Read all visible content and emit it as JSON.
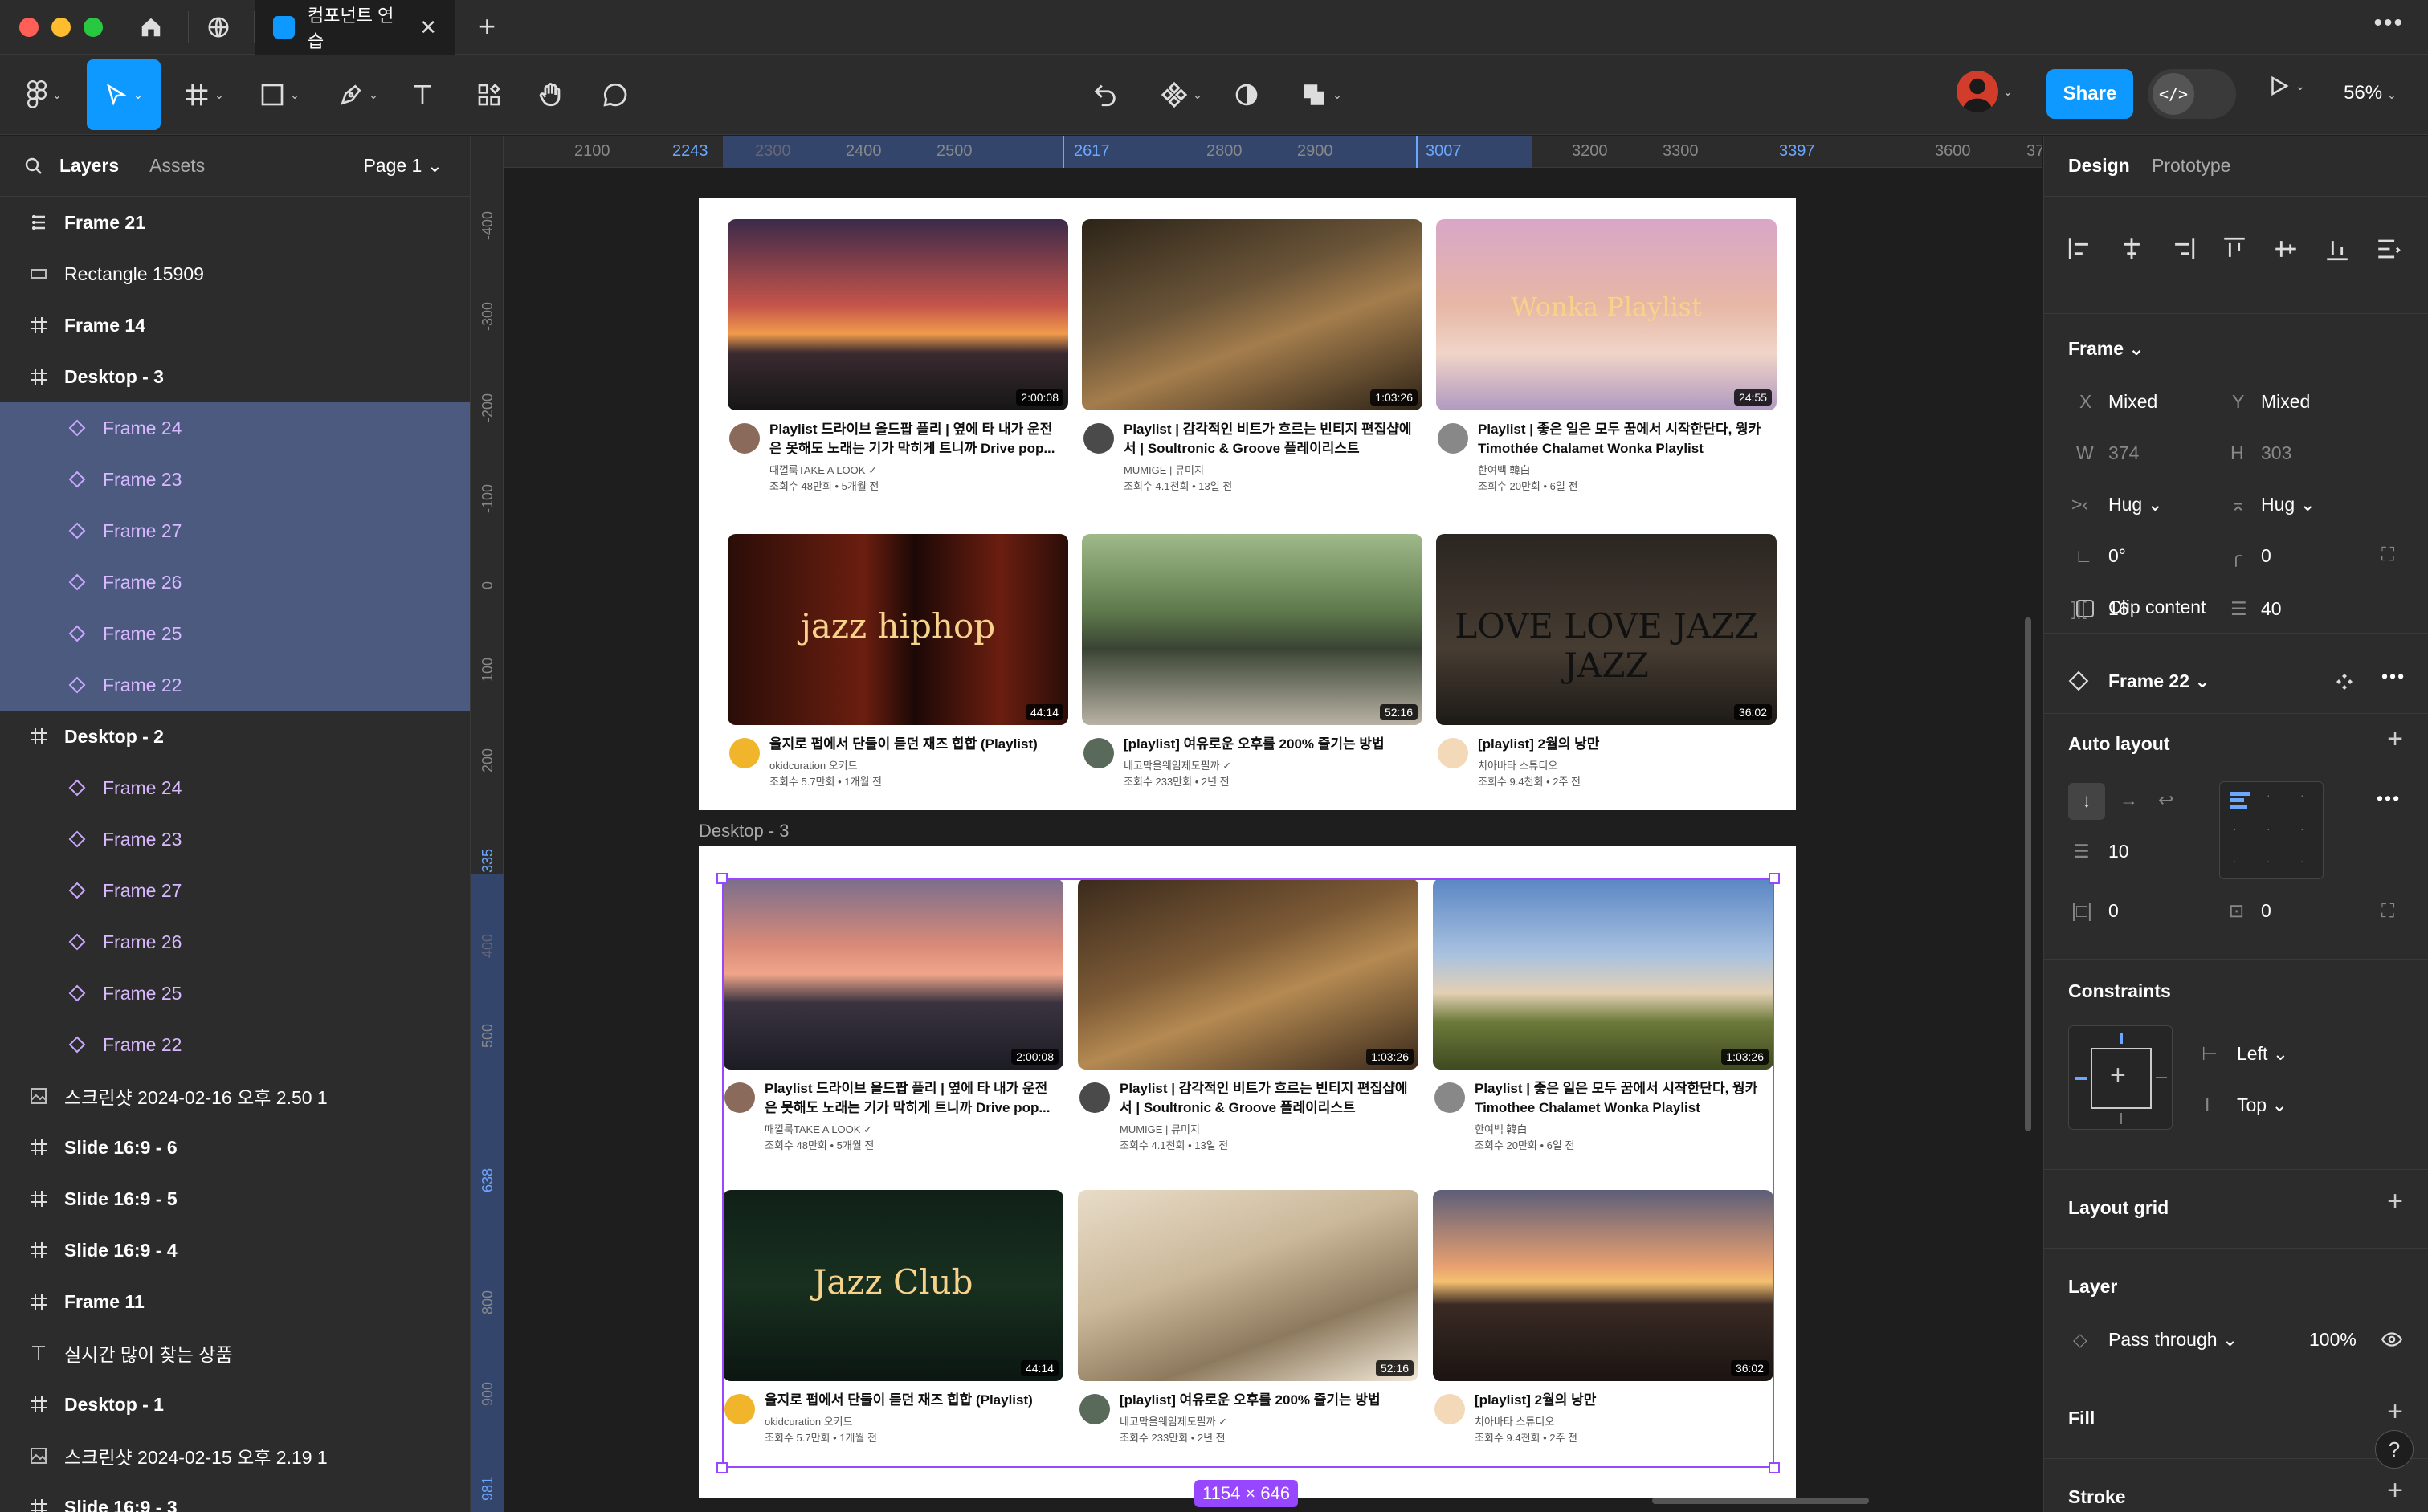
{
  "titlebar": {
    "file_tab_label": "컴포넌트 연습",
    "close_symbol": "✕",
    "new_tab_symbol": "+",
    "more_symbol": "•••"
  },
  "toolbar": {
    "share_label": "Share",
    "dev_mode_symbol": "</>",
    "zoom_label": "56%"
  },
  "left_panel": {
    "tabs": [
      "Layers",
      "Assets"
    ],
    "page_select": "Page 1 ⌄",
    "layers": [
      {
        "label": "Frame 21",
        "icon": "autolayout-icon",
        "level": 0,
        "selected": false,
        "bold": true
      },
      {
        "label": "Rectangle 15909",
        "icon": "rectangle-icon",
        "level": 0,
        "selected": false,
        "bold": false
      },
      {
        "label": "Frame 14",
        "icon": "frame-icon",
        "level": 0,
        "selected": false,
        "bold": true
      },
      {
        "label": "Desktop - 3",
        "icon": "frame-icon",
        "level": 0,
        "selected": false,
        "bold": true
      },
      {
        "label": "Frame 24",
        "icon": "instance-icon",
        "level": 1,
        "selected": true
      },
      {
        "label": "Frame 23",
        "icon": "instance-icon",
        "level": 1,
        "selected": true
      },
      {
        "label": "Frame 27",
        "icon": "instance-icon",
        "level": 1,
        "selected": true
      },
      {
        "label": "Frame 26",
        "icon": "instance-icon",
        "level": 1,
        "selected": true
      },
      {
        "label": "Frame 25",
        "icon": "instance-icon",
        "level": 1,
        "selected": true
      },
      {
        "label": "Frame 22",
        "icon": "instance-icon",
        "level": 1,
        "selected": true
      },
      {
        "label": "Desktop - 2",
        "icon": "frame-icon",
        "level": 0,
        "selected": false,
        "bold": true
      },
      {
        "label": "Frame 24",
        "icon": "instance-icon",
        "level": 1,
        "selected": false
      },
      {
        "label": "Frame 23",
        "icon": "instance-icon",
        "level": 1,
        "selected": false
      },
      {
        "label": "Frame 27",
        "icon": "instance-icon",
        "level": 1,
        "selected": false
      },
      {
        "label": "Frame 26",
        "icon": "instance-icon",
        "level": 1,
        "selected": false
      },
      {
        "label": "Frame 25",
        "icon": "instance-icon",
        "level": 1,
        "selected": false
      },
      {
        "label": "Frame 22",
        "icon": "instance-icon",
        "level": 1,
        "selected": false
      },
      {
        "label": "스크린샷 2024-02-16 오후 2.50 1",
        "icon": "image-icon",
        "level": 0,
        "selected": false,
        "bold": false
      },
      {
        "label": "Slide 16:9 - 6",
        "icon": "frame-icon",
        "level": 0,
        "selected": false,
        "bold": true
      },
      {
        "label": "Slide 16:9 - 5",
        "icon": "frame-icon",
        "level": 0,
        "selected": false,
        "bold": true
      },
      {
        "label": "Slide 16:9 - 4",
        "icon": "frame-icon",
        "level": 0,
        "selected": false,
        "bold": true
      },
      {
        "label": "Frame 11",
        "icon": "frame-icon",
        "level": 0,
        "selected": false,
        "bold": true
      },
      {
        "label": "실시간 많이 찾는 상품",
        "icon": "text-icon",
        "level": 0,
        "selected": false,
        "bold": false
      },
      {
        "label": "Desktop - 1",
        "icon": "frame-icon",
        "level": 0,
        "selected": false,
        "bold": true
      },
      {
        "label": "스크린샷 2024-02-15 오후 2.19 1",
        "icon": "image-icon",
        "level": 0,
        "selected": false,
        "bold": false
      },
      {
        "label": "Slide 16:9 - 3",
        "icon": "frame-icon",
        "level": 0,
        "selected": false,
        "bold": true
      }
    ]
  },
  "canvas": {
    "ruler_top": [
      "2100",
      "2243",
      "2300",
      "2400",
      "2500",
      "2617",
      "2800",
      "2900",
      "3007",
      "3200",
      "3300",
      "3397",
      "3600",
      "37"
    ],
    "ruler_left": [
      "-400",
      "-300",
      "-200",
      "-100",
      "0",
      "100",
      "200",
      "335",
      "400",
      "500",
      "638",
      "800",
      "900",
      "981"
    ],
    "frame_top_label": "",
    "frame_bottom_label": "Desktop - 3",
    "size_badge": "1154 × 646",
    "top_cards": [
      {
        "title": "Playlist 드라이브 올드팝 플리 | 옆에 타 내가 운전은 못해도 노래는 기가 막히게 트니까 Drive pop...",
        "channel": "때껄룩TAKE A LOOK ✓",
        "stats": "조회수 48만회 • 5개월 전",
        "duration": "2:00:08",
        "overlay": ""
      },
      {
        "title": "Playlist | 감각적인 비트가 흐르는 빈티지 편집샵에서 | Soultronic & Groove 플레이리스트",
        "channel": "MUMIGE | 뮤미지",
        "stats": "조회수 4.1천회 • 13일 전",
        "duration": "1:03:26",
        "overlay": ""
      },
      {
        "title": "Playlist | 좋은 일은 모두 꿈에서 시작한단다, 웡카 Timothée Chalamet Wonka Playlist",
        "channel": "한여백 韓白",
        "stats": "조회수 20만회 • 6일 전",
        "duration": "24:55",
        "overlay": "Wonka Playlist"
      },
      {
        "title": "을지로 펍에서 단둘이 듣던 재즈 힙합 (Playlist)",
        "channel": "okidcuration 오키드",
        "stats": "조회수 5.7만회 • 1개월 전",
        "duration": "44:14",
        "overlay": "jazz      hiphop"
      },
      {
        "title": "[playlist] 여유로운 오후를 200% 즐기는 방법",
        "channel": "네고막을웨임제도필까 ✓",
        "stats": "조회수 233만회 • 2년 전",
        "duration": "52:16",
        "overlay": ""
      },
      {
        "title": "[playlist] 2월의 낭만",
        "channel": "치아바타 스튜디오",
        "stats": "조회수 9.4천회 • 2주 전",
        "duration": "36:02",
        "overlay": "LOVE LOVE JAZZ JAZZ"
      }
    ],
    "bottom_cards": [
      {
        "title": "Playlist 드라이브 올드팝 플리 | 옆에 타 내가 운전은 못해도 노래는 기가 막히게 트니까 Drive pop...",
        "channel": "때껄룩TAKE A LOOK ✓",
        "stats": "조회수 48만회 • 5개월 전",
        "duration": "2:00:08",
        "overlay": ""
      },
      {
        "title": "Playlist | 감각적인 비트가 흐르는 빈티지 편집샵에서 | Soultronic & Groove 플레이리스트",
        "channel": "MUMIGE | 뮤미지",
        "stats": "조회수 4.1천회 • 13일 전",
        "duration": "1:03:26",
        "overlay": ""
      },
      {
        "title": "Playlist | 좋은 일은 모두 꿈에서 시작한단다, 웡카 Timothee Chalamet Wonka Playlist",
        "channel": "한여백 韓白",
        "stats": "조회수 20만회 • 6일 전",
        "duration": "1:03:26",
        "overlay": ""
      },
      {
        "title": "을지로 펍에서 단둘이 듣던 재즈 힙합 (Playlist)",
        "channel": "okidcuration 오키드",
        "stats": "조회수 5.7만회 • 1개월 전",
        "duration": "44:14",
        "overlay": "Jazz Club"
      },
      {
        "title": "[playlist] 여유로운 오후를 200% 즐기는 방법",
        "channel": "네고막을웨임제도필까 ✓",
        "stats": "조회수 233만회 • 2년 전",
        "duration": "52:16",
        "overlay": ""
      },
      {
        "title": "[playlist] 2월의 낭만",
        "channel": "치아바타 스튜디오",
        "stats": "조회수 9.4천회 • 2주 전",
        "duration": "36:02",
        "overlay": ""
      }
    ]
  },
  "right_panel": {
    "tabs": [
      "Design",
      "Prototype"
    ],
    "frame_section": {
      "title": "Frame ⌄",
      "x_label": "X",
      "x_value": "Mixed",
      "y_label": "Y",
      "y_value": "Mixed",
      "w_label": "W",
      "w_value": "374",
      "h_label": "H",
      "h_value": "303",
      "w_sizing": "Hug ⌄",
      "h_sizing": "Hug ⌄",
      "rotation": "0°",
      "radius": "0",
      "clip_content": "Clip content",
      "gap_h": "16",
      "gap_v": "40"
    },
    "component": {
      "name": "Frame 22 ⌄"
    },
    "auto_layout": {
      "title": "Auto layout",
      "spacing": "10",
      "padding_h": "0",
      "padding_v": "0"
    },
    "constraints": {
      "title": "Constraints",
      "horizontal": "Left ⌄",
      "vertical": "Top ⌄"
    },
    "layout_grid": {
      "title": "Layout grid"
    },
    "layer": {
      "title": "Layer",
      "blend": "Pass through ⌄",
      "opacity": "100%"
    },
    "fill": {
      "title": "Fill"
    },
    "stroke": {
      "title": "Stroke"
    },
    "help_symbol": "?"
  },
  "colors": {
    "accent": "#0d99ff",
    "selection": "#9747ff",
    "layer_selected_bg": "#4c5a80",
    "panel_bg": "#2c2c2c",
    "canvas_bg": "#1e1e1e"
  }
}
